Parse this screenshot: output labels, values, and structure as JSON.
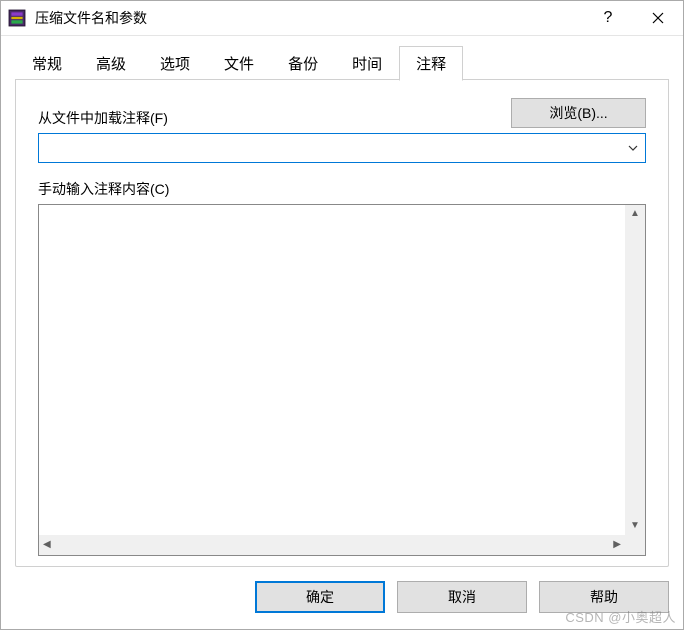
{
  "titlebar": {
    "title": "压缩文件名和参数"
  },
  "tabs": {
    "items": [
      {
        "label": "常规"
      },
      {
        "label": "高级"
      },
      {
        "label": "选项"
      },
      {
        "label": "文件"
      },
      {
        "label": "备份"
      },
      {
        "label": "时间"
      },
      {
        "label": "注释"
      }
    ],
    "active_index": 6
  },
  "panel": {
    "load_label": "从文件中加载注释(F)",
    "browse_label": "浏览(B)...",
    "combo_value": "",
    "manual_label": "手动输入注释内容(C)",
    "textarea_value": ""
  },
  "buttons": {
    "ok": "确定",
    "cancel": "取消",
    "help": "帮助"
  },
  "watermark": "CSDN @小奥超人"
}
